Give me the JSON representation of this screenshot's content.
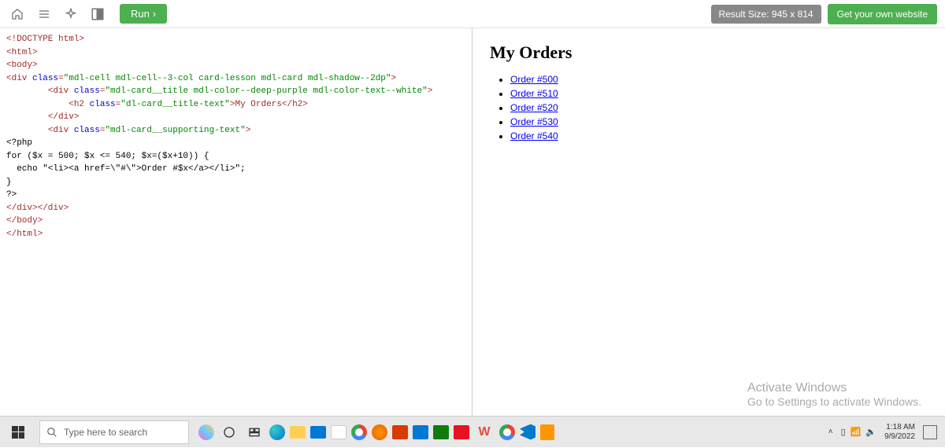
{
  "toolbar": {
    "run_label": "Run",
    "result_size": "Result Size: 945 x 814",
    "get_site": "Get your own website"
  },
  "editor": {
    "l1": "<!DOCTYPE html>",
    "l2": "<html>",
    "l3": "<body>",
    "l4_open": "<div ",
    "l4_class": "class",
    "l4_eq": "=",
    "l4_val": "\"mdl-cell mdl-cell--3-col card-lesson mdl-card mdl-shadow--2dp\"",
    "l4_close": ">",
    "l5_indent": "        ",
    "l5_open": "<div ",
    "l5_class": "class",
    "l5_eq": "=",
    "l5_val": "\"mdl-card__title mdl-color--deep-purple mdl-color-text--white\"",
    "l5_close": ">",
    "l6_indent": "            ",
    "l6_open": "<h2 ",
    "l6_class": "class",
    "l6_eq": "=",
    "l6_val": "\"dl-card__title-text\"",
    "l6_mid": ">My Orders</h2>",
    "l7_indent": "        ",
    "l7": "</div>",
    "l8_indent": "        ",
    "l8_open": "<div ",
    "l8_class": "class",
    "l8_eq": "=",
    "l8_val": "\"mdl-card__supporting-text\"",
    "l8_close": ">",
    "l9": "<?php",
    "l10": "for ($x = 500; $x <= 540; $x=($x+10)) {",
    "l11": "  echo \"<li><a href=\\\"#\\\">Order #$x</a></li>\";",
    "l12": "}",
    "l13": "?>",
    "l14": "</div></div>",
    "l15": "</body>",
    "l16": "</html>"
  },
  "preview": {
    "heading": "My Orders",
    "orders": [
      {
        "label": "Order #500"
      },
      {
        "label": "Order #510"
      },
      {
        "label": "Order #520"
      },
      {
        "label": "Order #530"
      },
      {
        "label": "Order #540"
      }
    ]
  },
  "watermark": {
    "line1": "Activate Windows",
    "line2": "Go to Settings to activate Windows."
  },
  "taskbar": {
    "search_placeholder": "Type here to search",
    "time": "1:18 AM",
    "date": "9/9/2022"
  }
}
